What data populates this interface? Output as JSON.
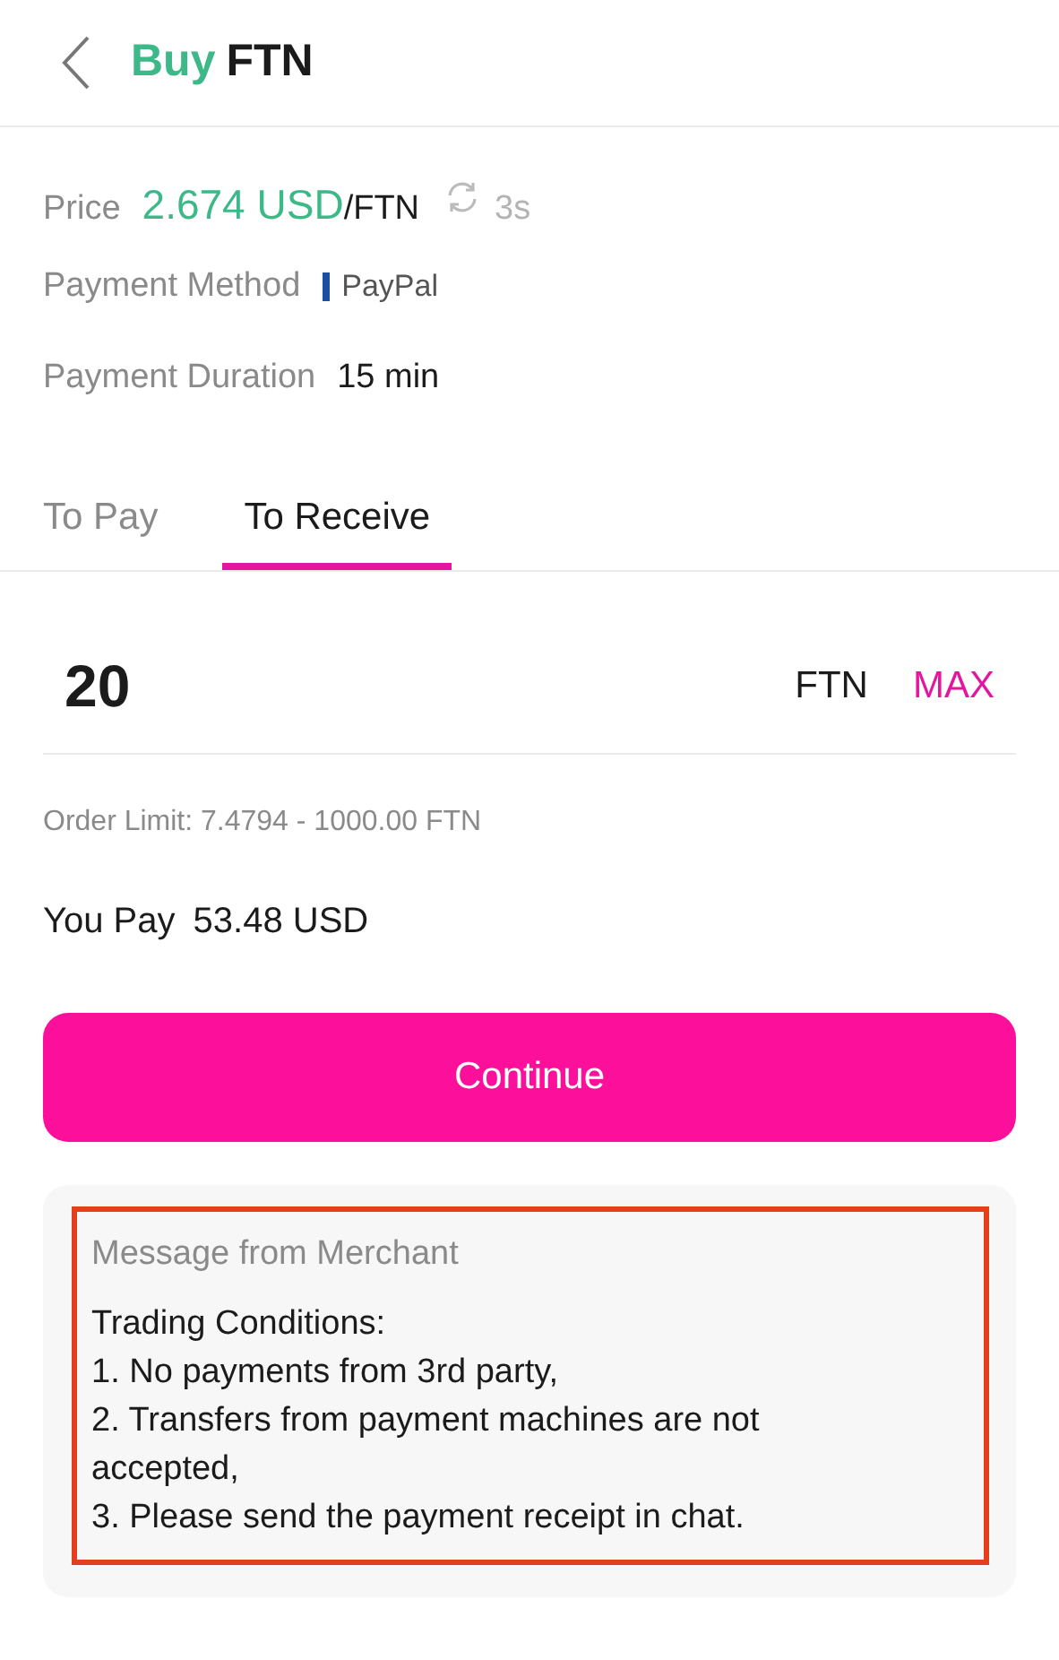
{
  "header": {
    "title_action": "Buy",
    "title_asset": "FTN"
  },
  "details": {
    "price_label": "Price",
    "price_value": "2.674 USD",
    "price_unit": "/FTN",
    "refresh_countdown": "3s",
    "method_label": "Payment Method",
    "method_value": "PayPal",
    "duration_label": "Payment Duration",
    "duration_value": "15 min"
  },
  "tabs": [
    {
      "label": "To Pay",
      "selected": false
    },
    {
      "label": "To Receive",
      "selected": true
    }
  ],
  "amount": {
    "value": "20",
    "currency": "FTN",
    "max_label": "MAX"
  },
  "order_limit": "Order Limit: 7.4794 - 1000.00 FTN",
  "you_pay": {
    "label": "You Pay",
    "value": "53.48 USD"
  },
  "continue_button": "Continue",
  "merchant_message": {
    "title": "Message from Merchant",
    "highlighted": true,
    "lines": [
      "Trading Conditions:",
      "1. No payments from 3rd party,",
      "2. Transfers from payment machines are not accepted,",
      "3. Please send the payment receipt in chat."
    ]
  }
}
